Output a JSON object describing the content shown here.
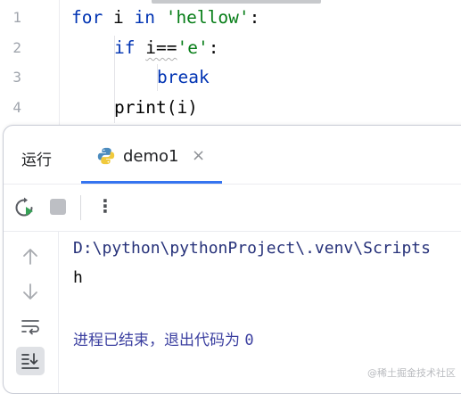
{
  "editor": {
    "line_numbers": [
      "1",
      "2",
      "3",
      "4"
    ],
    "lines": [
      {
        "kw1": "for",
        "t1": " i ",
        "kw2": "in",
        "t2": " ",
        "str": "'hellow'",
        "t3": ":"
      },
      {
        "kw": "if",
        "pre": " ",
        "warn": "i==",
        "str": "'e'",
        "post": ":"
      },
      {
        "kw": "break"
      },
      {
        "fn": "print",
        "args": "(i)"
      }
    ]
  },
  "run_panel": {
    "title": "运行",
    "tab_label": "demo1",
    "tab_close": "×",
    "toolbar": {
      "rerun_icon": "rerun-icon",
      "stop_icon": "stop-icon",
      "more_label": "⋮"
    },
    "side_icons": [
      "arrow-up-icon",
      "arrow-down-icon",
      "soft-wrap-icon",
      "scroll-to-end-icon"
    ],
    "console": {
      "path_line": "D:\\python\\pythonProject\\.venv\\Scripts",
      "output_line": "h",
      "exit_text": "进程已结束，退出代码为",
      "exit_code": "0"
    }
  },
  "watermark": "@稀土掘金技术社区",
  "colors": {
    "accent": "#3574f0",
    "keyword": "#0033b3",
    "string": "#067d17",
    "console_path": "#27327a"
  }
}
